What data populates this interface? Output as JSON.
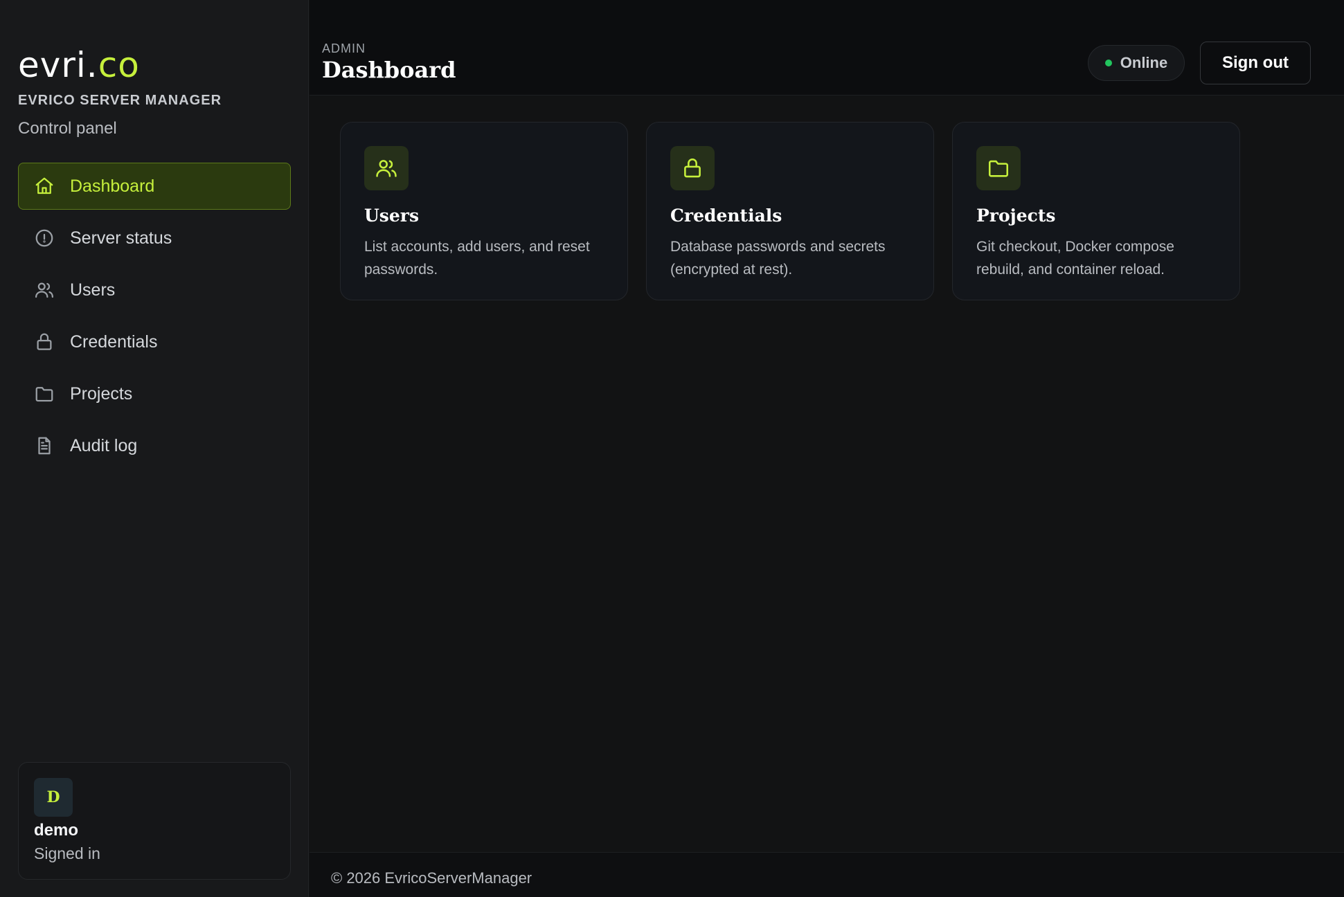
{
  "brand": {
    "logo_main": "evri.",
    "logo_accent": "co",
    "name": "EVRICO SERVER MANAGER",
    "tagline": "Control panel"
  },
  "sidebar": {
    "items": [
      {
        "label": "Dashboard",
        "icon": "home-icon",
        "active": true
      },
      {
        "label": "Server status",
        "icon": "circle-info-icon",
        "active": false
      },
      {
        "label": "Users",
        "icon": "users-icon",
        "active": false
      },
      {
        "label": "Credentials",
        "icon": "lock-icon",
        "active": false
      },
      {
        "label": "Projects",
        "icon": "folder-icon",
        "active": false
      },
      {
        "label": "Audit log",
        "icon": "file-text-icon",
        "active": false
      }
    ]
  },
  "user": {
    "avatar_initial": "D",
    "name": "demo",
    "status": "Signed in"
  },
  "header": {
    "eyebrow": "ADMIN",
    "title": "Dashboard",
    "status_label": "Online",
    "signout_label": "Sign out"
  },
  "cards": [
    {
      "title": "Users",
      "description": "List accounts, add users, and reset passwords.",
      "icon": "users-icon"
    },
    {
      "title": "Credentials",
      "description": "Database passwords and secrets (encrypted at rest).",
      "icon": "lock-icon"
    },
    {
      "title": "Projects",
      "description": "Git checkout, Docker compose rebuild, and container reload.",
      "icon": "folder-icon"
    }
  ],
  "footer": {
    "text": "© 2026 EvricoServerManager"
  },
  "colors": {
    "accent": "#c6f03c",
    "online": "#22c55e",
    "background": "#121314",
    "sidebar": "#18191b"
  }
}
